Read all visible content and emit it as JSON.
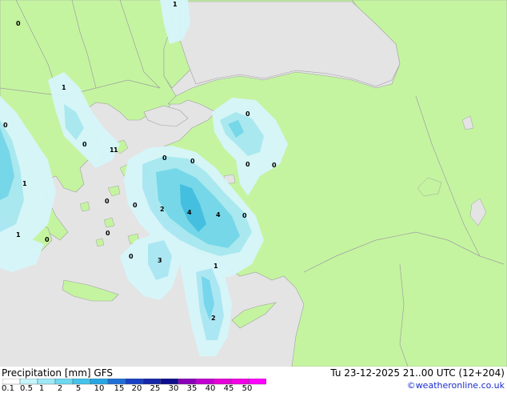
{
  "footer": {
    "product": "Precipitation [mm]",
    "model": "GFS",
    "run_time": "Tu 23-12-2025 21..00 UTC (12+204)",
    "credit": "©weatheronline.co.uk"
  },
  "legend": {
    "ticks": [
      "0.1",
      "0.5",
      "1",
      "2",
      "5",
      "10",
      "15",
      "20",
      "25",
      "30",
      "35",
      "40",
      "45",
      "50"
    ],
    "colors": [
      "#ffffff",
      "#c6f4fb",
      "#9ee8f6",
      "#6ed9f0",
      "#45c3ea",
      "#27a6e2",
      "#1f6fd6",
      "#1940c6",
      "#1526a8",
      "#0e0e8c",
      "#8a00b8",
      "#c000d0",
      "#e600d8",
      "#f200e6",
      "#ff00ff"
    ]
  },
  "map_labels": [
    {
      "text": "0"
    },
    {
      "text": "1"
    },
    {
      "text": "0"
    },
    {
      "text": "1"
    },
    {
      "text": "0"
    },
    {
      "text": "1"
    },
    {
      "text": "0"
    },
    {
      "text": "1"
    },
    {
      "text": "0"
    },
    {
      "text": "0"
    },
    {
      "text": "0"
    },
    {
      "text": "0"
    },
    {
      "text": "0"
    },
    {
      "text": "2"
    },
    {
      "text": "4"
    },
    {
      "text": "4"
    },
    {
      "text": "0"
    },
    {
      "text": "1"
    },
    {
      "text": "0"
    },
    {
      "text": "0"
    },
    {
      "text": "0"
    },
    {
      "text": "0"
    },
    {
      "text": "3"
    },
    {
      "text": "1"
    },
    {
      "text": "2"
    },
    {
      "text": "1"
    }
  ],
  "colors": {
    "sea": "#e4e4e4",
    "land": "#c4f4a0",
    "border": "#a0a0a0",
    "precip_light": "#d6f6fb",
    "precip_medium": "#a8e8f4",
    "precip_heavy": "#72d6ec",
    "precip_core": "#3fbde4"
  }
}
